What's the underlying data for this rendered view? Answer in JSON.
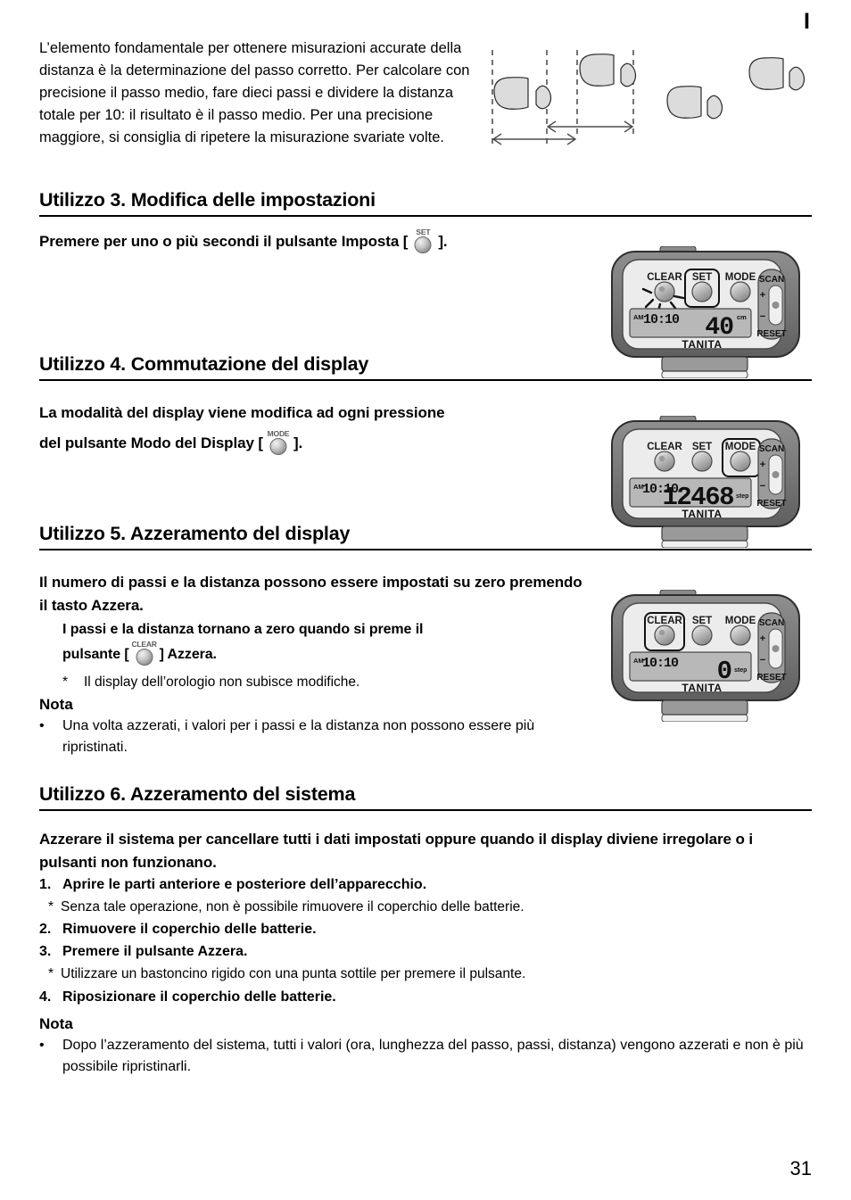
{
  "header": {
    "language_marker": "I"
  },
  "page_number": "31",
  "intro": {
    "text": "L’elemento fondamentale per ottenere misurazioni accurate della distanza è la determinazione del passo corretto. Per calcolare con precisione il passo medio, fare dieci passi e dividere la distanza totale per 10: il risultato è il passo medio. Per una precisione maggiore, si consiglia di ripetere la misurazione svariate volte."
  },
  "diagram": {
    "name": "stride-measurement-diagram",
    "description": "Footprints with dashed reference lines and double-headed measurement arrows"
  },
  "sections": [
    {
      "heading": "Utilizzo 3. Modifica delle impostazioni",
      "lead_before": "Premere per uno o più secondi il pulsante Imposta [",
      "lead_button": "SET",
      "lead_after": "]."
    },
    {
      "heading": "Utilizzo 4. Commutazione del display",
      "line1": "La modalità del display viene modifica ad ogni pressione",
      "line2_before": "del pulsante Modo del Display  [",
      "line2_button": "MODE",
      "line2_after": "]."
    },
    {
      "heading": "Utilizzo 5. Azzeramento del display",
      "lead": "Il numero di passi e la distanza possono essere impostati su zero premendo il tasto Azzera.",
      "sub_line1": "I passi e la distanza tornano a zero quando si preme il",
      "sub_line2_before": "pulsante [",
      "sub_line2_button": "CLEAR",
      "sub_line2_after": "] Azzera.",
      "star_note": "Il display dell’orologio non subisce modifiche.",
      "nota_title": "Nota",
      "nota_bullet": "Una volta azzerati, i valori per i passi e la distanza non possono essere più ripristinati."
    },
    {
      "heading": "Utilizzo 6. Azzeramento del sistema",
      "lead": "Azzerare il sistema per cancellare tutti i dati impostati oppure quando il display diviene irregolare o i pulsanti non funzionano.",
      "steps": [
        {
          "num": "1.",
          "text": "Aprire le parti anteriore e posteriore dell’apparecchio.",
          "note": "Senza tale operazione, non è possibile rimuovere il coperchio delle batterie."
        },
        {
          "num": "2.",
          "text": "Rimuovere il coperchio delle batterie.",
          "note": ""
        },
        {
          "num": "3.",
          "text": "Premere il pulsante Azzera.",
          "note": "Utilizzare un bastoncino rigido con una punta sottile per premere il pulsante."
        },
        {
          "num": "4.",
          "text": "Riposizionare il coperchio delle batterie.",
          "note": ""
        }
      ],
      "nota_title": "Nota",
      "nota_bullet": "Dopo l’azzeramento del sistema, tutti i valori (ora, lunghezza del passo, passi, distanza) vengono azzerati e non è più possibile ripristinarli."
    }
  ],
  "star_symbol": "*",
  "bullet_symbol": "•",
  "devices": [
    {
      "id": "device-set",
      "buttons": [
        "CLEAR",
        "SET",
        "MODE"
      ],
      "highlighted_button": "SET",
      "blinking_button": "CLEAR",
      "slider": {
        "top_label": "SCAN",
        "plus": "+",
        "minus": "−",
        "bottom_label": "RESET"
      },
      "lcd": {
        "ampm": "AM",
        "time": "10:10",
        "value": "40",
        "unit": "cm"
      },
      "brand": "TANITA"
    },
    {
      "id": "device-mode",
      "buttons": [
        "CLEAR",
        "SET",
        "MODE"
      ],
      "highlighted_button": "MODE",
      "blinking_button": "",
      "slider": {
        "top_label": "SCAN",
        "plus": "+",
        "minus": "−",
        "bottom_label": "RESET"
      },
      "lcd": {
        "ampm": "AM",
        "time": "10:10",
        "value": "12468",
        "unit": "step"
      },
      "brand": "TANITA"
    },
    {
      "id": "device-clear",
      "buttons": [
        "CLEAR",
        "SET",
        "MODE"
      ],
      "highlighted_button": "CLEAR",
      "blinking_button": "",
      "slider": {
        "top_label": "SCAN",
        "plus": "+",
        "minus": "−",
        "bottom_label": "RESET"
      },
      "lcd": {
        "ampm": "AM",
        "time": "10:10",
        "value": "0",
        "unit": "step"
      },
      "brand": "TANITA"
    }
  ],
  "colors": {
    "case_dark": "#7a7a7a",
    "case_face": "#e8e8e8",
    "lcd": "#b9b9b9",
    "text": "#000000"
  }
}
